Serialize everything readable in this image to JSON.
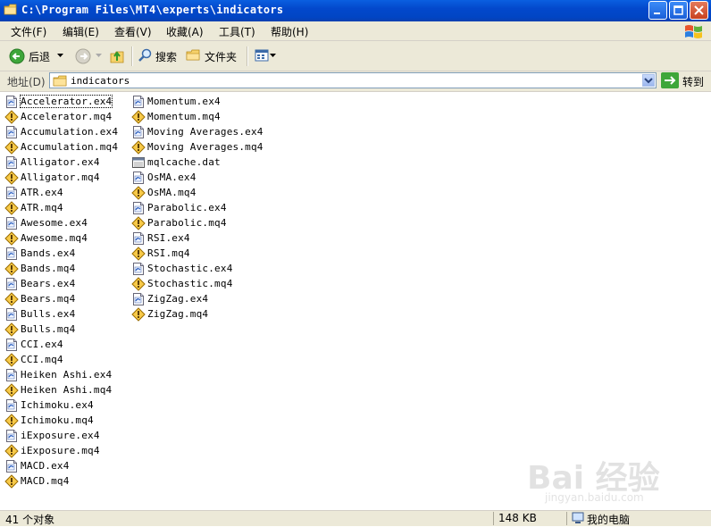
{
  "window": {
    "title": "C:\\Program Files\\MT4\\experts\\indicators"
  },
  "menu": [
    {
      "label": "文件(F)"
    },
    {
      "label": "编辑(E)"
    },
    {
      "label": "查看(V)"
    },
    {
      "label": "收藏(A)"
    },
    {
      "label": "工具(T)"
    },
    {
      "label": "帮助(H)"
    }
  ],
  "toolbar": {
    "back_label": "后退",
    "search_label": "搜索",
    "folders_label": "文件夹"
  },
  "address": {
    "label": "地址(D)",
    "value": "indicators",
    "go_label": "转到"
  },
  "files_col1": [
    {
      "name": "Accelerator.ex4",
      "type": "ex4"
    },
    {
      "name": "Accelerator.mq4",
      "type": "mq4"
    },
    {
      "name": "Accumulation.ex4",
      "type": "ex4"
    },
    {
      "name": "Accumulation.mq4",
      "type": "mq4"
    },
    {
      "name": "Alligator.ex4",
      "type": "ex4"
    },
    {
      "name": "Alligator.mq4",
      "type": "mq4"
    },
    {
      "name": "ATR.ex4",
      "type": "ex4"
    },
    {
      "name": "ATR.mq4",
      "type": "mq4"
    },
    {
      "name": "Awesome.ex4",
      "type": "ex4"
    },
    {
      "name": "Awesome.mq4",
      "type": "mq4"
    },
    {
      "name": "Bands.ex4",
      "type": "ex4"
    },
    {
      "name": "Bands.mq4",
      "type": "mq4"
    },
    {
      "name": "Bears.ex4",
      "type": "ex4"
    },
    {
      "name": "Bears.mq4",
      "type": "mq4"
    },
    {
      "name": "Bulls.ex4",
      "type": "ex4"
    },
    {
      "name": "Bulls.mq4",
      "type": "mq4"
    },
    {
      "name": "CCI.ex4",
      "type": "ex4"
    },
    {
      "name": "CCI.mq4",
      "type": "mq4"
    },
    {
      "name": "Heiken Ashi.ex4",
      "type": "ex4"
    },
    {
      "name": "Heiken Ashi.mq4",
      "type": "mq4"
    },
    {
      "name": "Ichimoku.ex4",
      "type": "ex4"
    },
    {
      "name": "Ichimoku.mq4",
      "type": "mq4"
    },
    {
      "name": "iExposure.ex4",
      "type": "ex4"
    },
    {
      "name": "iExposure.mq4",
      "type": "mq4"
    },
    {
      "name": "MACD.ex4",
      "type": "ex4"
    },
    {
      "name": "MACD.mq4",
      "type": "mq4"
    }
  ],
  "files_col2": [
    {
      "name": "Momentum.ex4",
      "type": "ex4"
    },
    {
      "name": "Momentum.mq4",
      "type": "mq4"
    },
    {
      "name": "Moving Averages.ex4",
      "type": "ex4"
    },
    {
      "name": "Moving Averages.mq4",
      "type": "mq4"
    },
    {
      "name": "mqlcache.dat",
      "type": "dat"
    },
    {
      "name": "OsMA.ex4",
      "type": "ex4"
    },
    {
      "name": "OsMA.mq4",
      "type": "mq4"
    },
    {
      "name": "Parabolic.ex4",
      "type": "ex4"
    },
    {
      "name": "Parabolic.mq4",
      "type": "mq4"
    },
    {
      "name": "RSI.ex4",
      "type": "ex4"
    },
    {
      "name": "RSI.mq4",
      "type": "mq4"
    },
    {
      "name": "Stochastic.ex4",
      "type": "ex4"
    },
    {
      "name": "Stochastic.mq4",
      "type": "mq4"
    },
    {
      "name": "ZigZag.ex4",
      "type": "ex4"
    },
    {
      "name": "ZigZag.mq4",
      "type": "mq4"
    }
  ],
  "status": {
    "count": "41 个对象",
    "size": "148 KB",
    "location": "我的电脑"
  },
  "watermark": {
    "logo": "Bai 经验",
    "url": "jingyan.baidu.com"
  },
  "colors": {
    "titlebar": "#0348cc",
    "chrome": "#ece9d8"
  }
}
